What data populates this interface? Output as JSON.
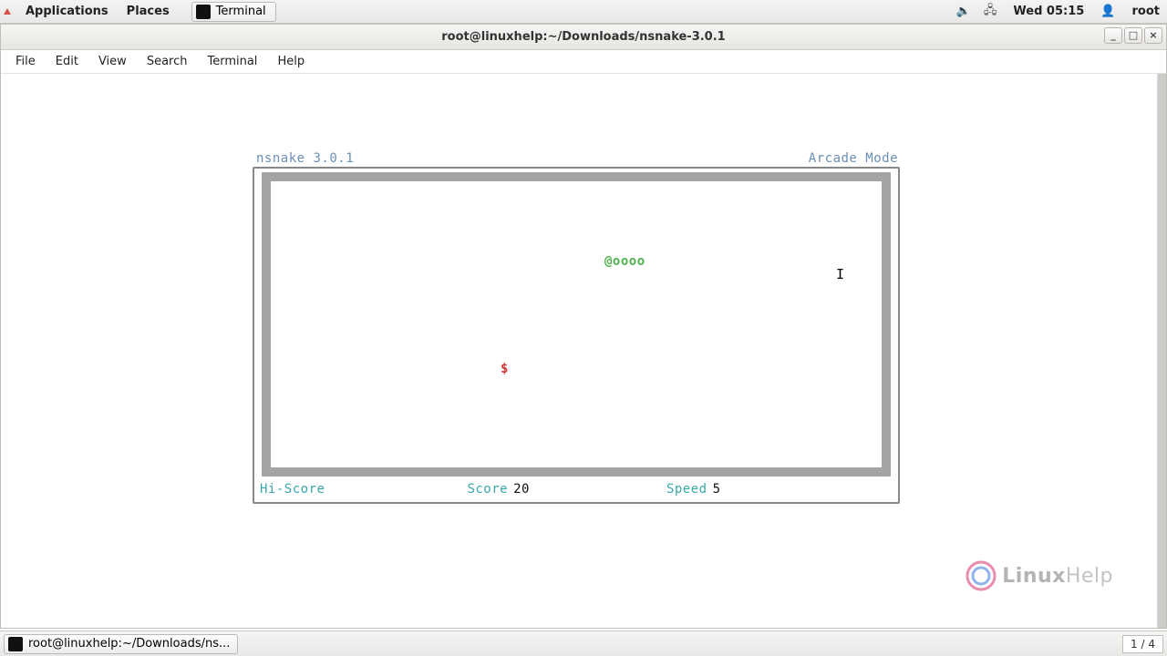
{
  "top_panel": {
    "applications": "Applications",
    "places": "Places",
    "active_app": "Terminal",
    "datetime": "Wed 05:15",
    "user": "root"
  },
  "window": {
    "title": "root@linuxhelp:~/Downloads/nsnake-3.0.1",
    "buttons": {
      "min": "_",
      "max": "□",
      "close": "×"
    },
    "menus": [
      "File",
      "Edit",
      "View",
      "Search",
      "Terminal",
      "Help"
    ]
  },
  "game": {
    "program": "nsnake 3.0.1",
    "mode": "Arcade Mode",
    "snake_glyph": "@oooo",
    "food_glyph": "$",
    "cursor_glyph": "I",
    "status": {
      "hiscore_label": "Hi-Score",
      "hiscore_value": "",
      "score_label": "Score",
      "score_value": "20",
      "speed_label": "Speed",
      "speed_value": "5"
    }
  },
  "watermark": {
    "text_a": "Linux",
    "text_b": "Help"
  },
  "bottom": {
    "task": "root@linuxhelp:~/Downloads/ns...",
    "page": "1 / 4"
  }
}
